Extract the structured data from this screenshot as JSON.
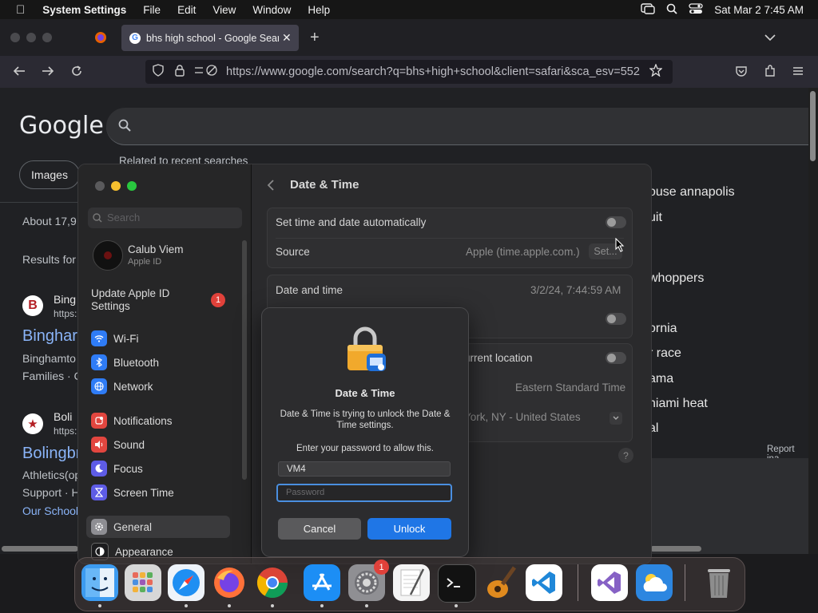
{
  "menubar": {
    "app_name": "System Settings",
    "items": [
      "File",
      "Edit",
      "View",
      "Window",
      "Help"
    ],
    "datetime": "Sat Mar 2  7:45 AM"
  },
  "browser": {
    "tab_title": "bhs high school - Google Search",
    "url": "https://www.google.com/search?q=bhs+high+school&client=safari&sca_esv=552",
    "url_domain_bold": "google.com"
  },
  "google": {
    "logo": "Google",
    "related_label": "Related to recent searches",
    "images_chip": "Images",
    "results_count": "About 17,9",
    "results_for": "Results for",
    "result1": {
      "name": "Bing",
      "url": "https:",
      "title": "Binghar",
      "snippet1": "Binghamto",
      "snippet2": "Families · C"
    },
    "result2": {
      "name": "Boli",
      "url": "https:",
      "title": "Bolingbr",
      "snippet1": "Athletics(op",
      "snippet2": "Support · H",
      "link": "Our School"
    },
    "right_items": [
      "ouse annapolis",
      "uit",
      "whoppers",
      "ornia",
      "r race",
      "ama",
      "niami heat",
      "al"
    ],
    "report": "Report ina"
  },
  "settings": {
    "search_placeholder": "Search",
    "user_name": "Calub Viem",
    "user_sub": "Apple ID",
    "update_label": "Update Apple ID Settings",
    "update_badge": "1",
    "sidebar_items": [
      {
        "label": "Wi-Fi",
        "icon": "wifi-icon",
        "color": "#2f7cf6"
      },
      {
        "label": "Bluetooth",
        "icon": "bluetooth-icon",
        "color": "#2f7cf6"
      },
      {
        "label": "Network",
        "icon": "globe-icon",
        "color": "#2f7cf6"
      },
      {
        "label": "Notifications",
        "icon": "bell-icon",
        "color": "#e2463f"
      },
      {
        "label": "Sound",
        "icon": "speaker-icon",
        "color": "#e2463f"
      },
      {
        "label": "Focus",
        "icon": "moon-icon",
        "color": "#5e5ce6"
      },
      {
        "label": "Screen Time",
        "icon": "hourglass-icon",
        "color": "#5e5ce6"
      },
      {
        "label": "General",
        "icon": "gear-icon",
        "color": "#8e8e93"
      },
      {
        "label": "Appearance",
        "icon": "appearance-icon",
        "color": "#1c1c1e"
      }
    ],
    "title": "Date & Time",
    "auto_label": "Set time and date automatically",
    "source_label": "Source",
    "source_value": "Apple (time.apple.com.)",
    "set_button": "Set...",
    "date_time_label": "Date and time",
    "date_time_value": "3/2/24, 7:44:59 AM",
    "current_location_label": "urrent location",
    "timezone_value": "Eastern Standard Time",
    "closest_city": "York, NY - United States",
    "help": "?"
  },
  "dialog": {
    "title": "Date & Time",
    "message": "Date & Time is trying to unlock the Date & Time settings.",
    "prompt": "Enter your password to allow this.",
    "username": "VM4",
    "password_placeholder": "Password",
    "cancel": "Cancel",
    "unlock": "Unlock"
  },
  "dock": {
    "apps": [
      "finder-icon",
      "launchpad-icon",
      "safari-icon",
      "firefox-icon",
      "chrome-icon",
      "app-store-icon",
      "system-settings-icon",
      "textedit-icon",
      "terminal-icon",
      "garageband-icon",
      "vscode-icon",
      "visual-studio-icon",
      "weather-icon",
      "trash-icon"
    ],
    "settings_badge": "1"
  }
}
